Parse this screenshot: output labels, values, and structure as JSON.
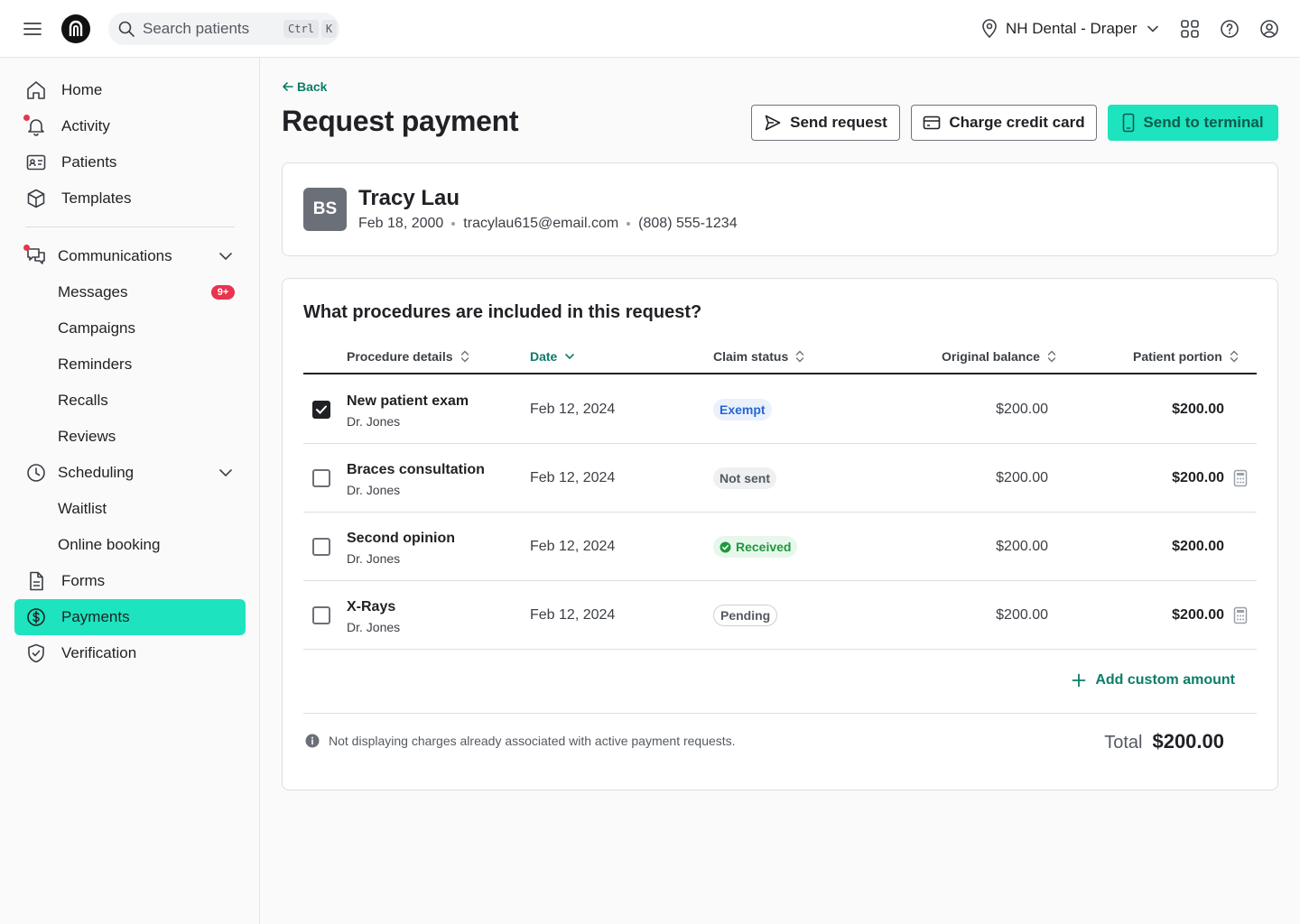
{
  "topbar": {
    "search_placeholder": "Search patients",
    "shortcut_keys": [
      "Ctrl",
      "K"
    ],
    "location": "NH Dental - Draper"
  },
  "sidebar": {
    "items": [
      {
        "label": "Home",
        "icon": "home-icon"
      },
      {
        "label": "Activity",
        "icon": "bell-icon",
        "notification_dot": true
      },
      {
        "label": "Patients",
        "icon": "id-card-icon"
      },
      {
        "label": "Templates",
        "icon": "box-icon"
      },
      {
        "label": "Communications",
        "icon": "chat-icon",
        "notification_dot": true,
        "expanded": true
      },
      {
        "label": "Messages",
        "badge": "9+"
      },
      {
        "label": "Campaigns"
      },
      {
        "label": "Reminders"
      },
      {
        "label": "Recalls"
      },
      {
        "label": "Reviews"
      },
      {
        "label": "Scheduling",
        "icon": "clock-icon",
        "expanded": true
      },
      {
        "label": "Waitlist"
      },
      {
        "label": "Online booking"
      },
      {
        "label": "Forms",
        "icon": "document-icon"
      },
      {
        "label": "Payments",
        "icon": "dollar-circle-icon",
        "active": true
      },
      {
        "label": "Verification",
        "icon": "shield-check-icon"
      }
    ]
  },
  "page": {
    "back_label": "Back",
    "title": "Request payment",
    "actions": {
      "send_request": "Send request",
      "charge_card": "Charge credit card",
      "send_terminal": "Send to terminal"
    }
  },
  "patient": {
    "initials": "BS",
    "name": "Tracy Lau",
    "dob": "Feb 18, 2000",
    "email": "tracylau615@email.com",
    "phone": "(808) 555-1234"
  },
  "procedures": {
    "question": "What procedures are included in this request?",
    "columns": {
      "details": "Procedure details",
      "date": "Date",
      "claim": "Claim status",
      "original": "Original balance",
      "portion": "Patient portion"
    },
    "rows": [
      {
        "name": "New patient exam",
        "provider": "Dr. Jones",
        "date": "Feb 12, 2024",
        "status": "Exempt",
        "original": "$200.00",
        "portion": "$200.00",
        "checked": true
      },
      {
        "name": "Braces consultation",
        "provider": "Dr. Jones",
        "date": "Feb 12, 2024",
        "status": "Not sent",
        "original": "$200.00",
        "portion": "$200.00",
        "checked": false
      },
      {
        "name": "Second opinion",
        "provider": "Dr. Jones",
        "date": "Feb 12, 2024",
        "status": "Received",
        "original": "$200.00",
        "portion": "$200.00",
        "checked": false
      },
      {
        "name": "X-Rays",
        "provider": "Dr. Jones",
        "date": "Feb 12, 2024",
        "status": "Pending",
        "original": "$200.00",
        "portion": "$200.00",
        "checked": false
      }
    ],
    "add_custom": "Add custom amount",
    "note": "Not displaying charges already associated with active payment requests.",
    "total_label": "Total",
    "total_value": "$200.00"
  },
  "colors": {
    "accent": "#1de4bf",
    "accent_text": "#0b7d68",
    "notification": "#e8344e"
  }
}
